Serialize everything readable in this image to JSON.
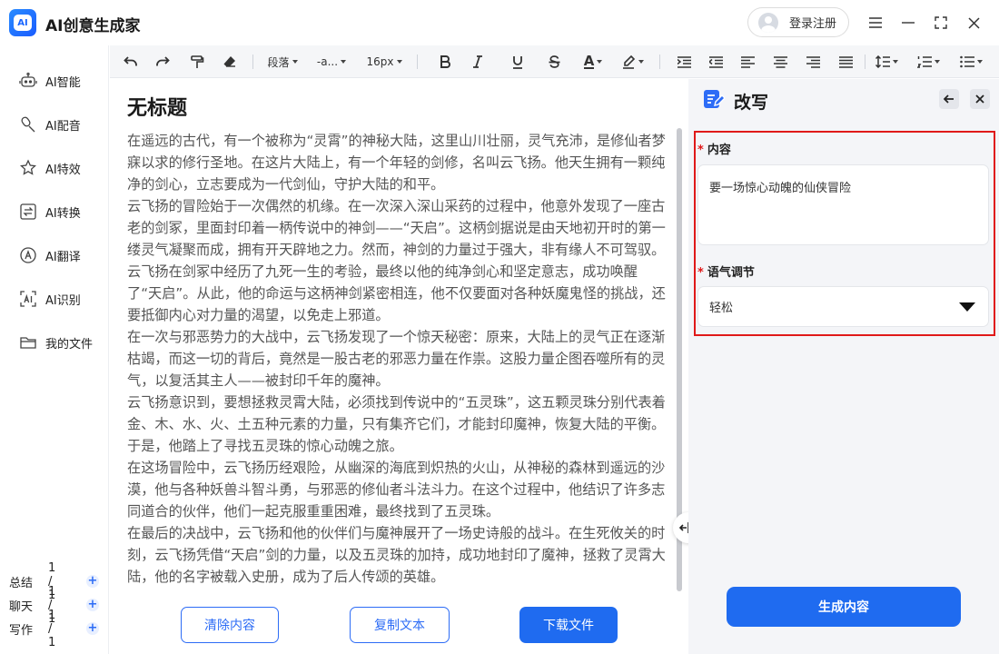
{
  "app": {
    "title": "AI创意生成家",
    "logo_text": "AI"
  },
  "header": {
    "login_label": "登录注册"
  },
  "sidebar": {
    "items": [
      {
        "label": "AI智能",
        "icon": "robot-icon"
      },
      {
        "label": "AI配音",
        "icon": "microphone-icon"
      },
      {
        "label": "AI特效",
        "icon": "sparkle-star-icon"
      },
      {
        "label": "AI转换",
        "icon": "convert-icon"
      },
      {
        "label": "AI翻译",
        "icon": "translate-icon"
      },
      {
        "label": "AI识别",
        "icon": "ai-recognition-icon"
      },
      {
        "label": "我的文件",
        "icon": "folder-icon"
      }
    ],
    "stats": [
      {
        "label": "总结",
        "count": "1 / 1"
      },
      {
        "label": "聊天",
        "count": "1 / 1"
      },
      {
        "label": "写作",
        "count": "1 / 1"
      }
    ]
  },
  "toolbar": {
    "paragraph": "段落",
    "font": "-a...",
    "font_size": "16px"
  },
  "editor": {
    "title": "无标题",
    "paragraphs": [
      "在遥远的古代，有一个被称为“灵霄”的神秘大陆，这里山川壮丽，灵气充沛，是修仙者梦寐以求的修行圣地。在这片大陆上，有一个年轻的剑修，名叫云飞扬。他天生拥有一颗纯净的剑心，立志要成为一代剑仙，守护大陆的和平。",
      "云飞扬的冒险始于一次偶然的机缘。在一次深入深山采药的过程中，他意外发现了一座古老的剑冢，里面封印着一柄传说中的神剑——“天启”。这柄剑据说是由天地初开时的第一缕灵气凝聚而成，拥有开天辟地之力。然而，神剑的力量过于强大，非有缘人不可驾驭。",
      "云飞扬在剑冢中经历了九死一生的考验，最终以他的纯净剑心和坚定意志，成功唤醒了“天启”。从此，他的命运与这柄神剑紧密相连，他不仅要面对各种妖魔鬼怪的挑战，还要抵御内心对力量的渴望，以免走上邪道。",
      "在一次与邪恶势力的大战中，云飞扬发现了一个惊天秘密：原来，大陆上的灵气正在逐渐枯竭，而这一切的背后，竟然是一股古老的邪恶力量在作祟。这股力量企图吞噬所有的灵气，以复活其主人——被封印千年的魔神。",
      "云飞扬意识到，要想拯救灵霄大陆，必须找到传说中的“五灵珠”，这五颗灵珠分别代表着金、木、水、火、土五种元素的力量，只有集齐它们，才能封印魔神，恢复大陆的平衡。于是，他踏上了寻找五灵珠的惊心动魄之旅。",
      "在这场冒险中，云飞扬历经艰险，从幽深的海底到炽热的火山，从神秘的森林到遥远的沙漠，他与各种妖兽斗智斗勇，与邪恶的修仙者斗法斗力。在这个过程中，他结识了许多志同道合的伙伴，他们一起克服重重困难，最终找到了五灵珠。",
      "在最后的决战中，云飞扬和他的伙伴们与魔神展开了一场史诗般的战斗。在生死攸关的时刻，云飞扬凭借“天启”剑的力量，以及五灵珠的加持，成功地封印了魔神，拯救了灵霄大陆，他的名字被载入史册，成为了后人传颂的英雄。"
    ],
    "buttons": {
      "clear": "清除内容",
      "copy": "复制文本",
      "download": "下载文件"
    }
  },
  "panel": {
    "title": "改写",
    "content_label": "内容",
    "content_value": "要一场惊心动魄的仙侠冒险",
    "tone_label": "语气调节",
    "tone_value": "轻松",
    "generate_label": "生成内容"
  },
  "colors": {
    "accent": "#1f6bf0",
    "highlight_border": "#e01919",
    "panel_bg": "#f4f5f8"
  }
}
